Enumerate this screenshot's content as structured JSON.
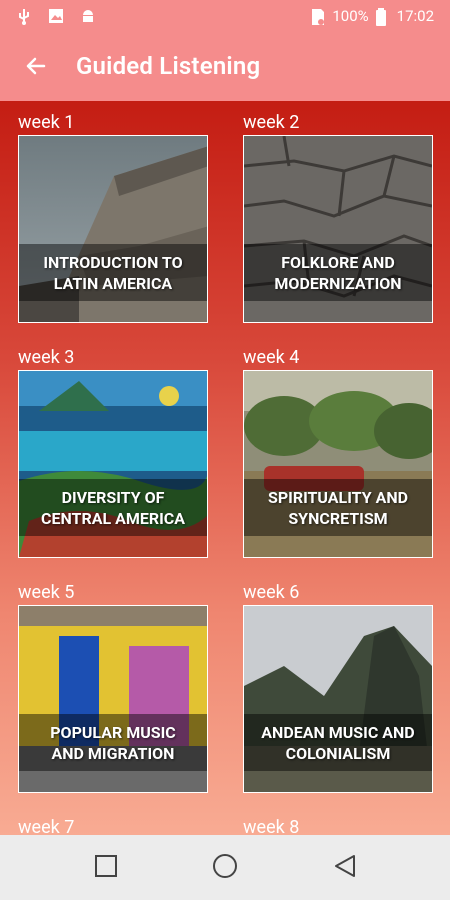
{
  "status_bar": {
    "battery": "100%",
    "time": "17:02",
    "left_icons": [
      "usb-icon",
      "image-icon",
      "android-icon"
    ],
    "right_icons": [
      "sim-icon",
      "battery-icon"
    ]
  },
  "app_bar": {
    "title": "Guided Listening",
    "back_icon": "arrow-left-icon",
    "color": "#f58c8c"
  },
  "weeks": [
    {
      "label": "week 1",
      "title_line1": "INTRODUCTION TO",
      "title_line2": "LATIN AMERICA"
    },
    {
      "label": "week 2",
      "title_line1": "FOLKLORE AND",
      "title_line2": "MODERNIZATION"
    },
    {
      "label": "week 3",
      "title_line1": "DIVERSITY OF",
      "title_line2": "CENTRAL AMERICA"
    },
    {
      "label": "week 4",
      "title_line1": "SPIRITUALITY AND",
      "title_line2": "SYNCRETISM"
    },
    {
      "label": "week 5",
      "title_line1": "POPULAR MUSIC",
      "title_line2": "AND MIGRATION"
    },
    {
      "label": "week 6",
      "title_line1": "ANDEAN MUSIC AND",
      "title_line2": "COLONIALISM"
    },
    {
      "label": "week 7"
    },
    {
      "label": "week 8"
    }
  ],
  "nav_bar": {
    "icons": [
      "recents-square-icon",
      "home-circle-icon",
      "back-triangle-icon"
    ]
  }
}
